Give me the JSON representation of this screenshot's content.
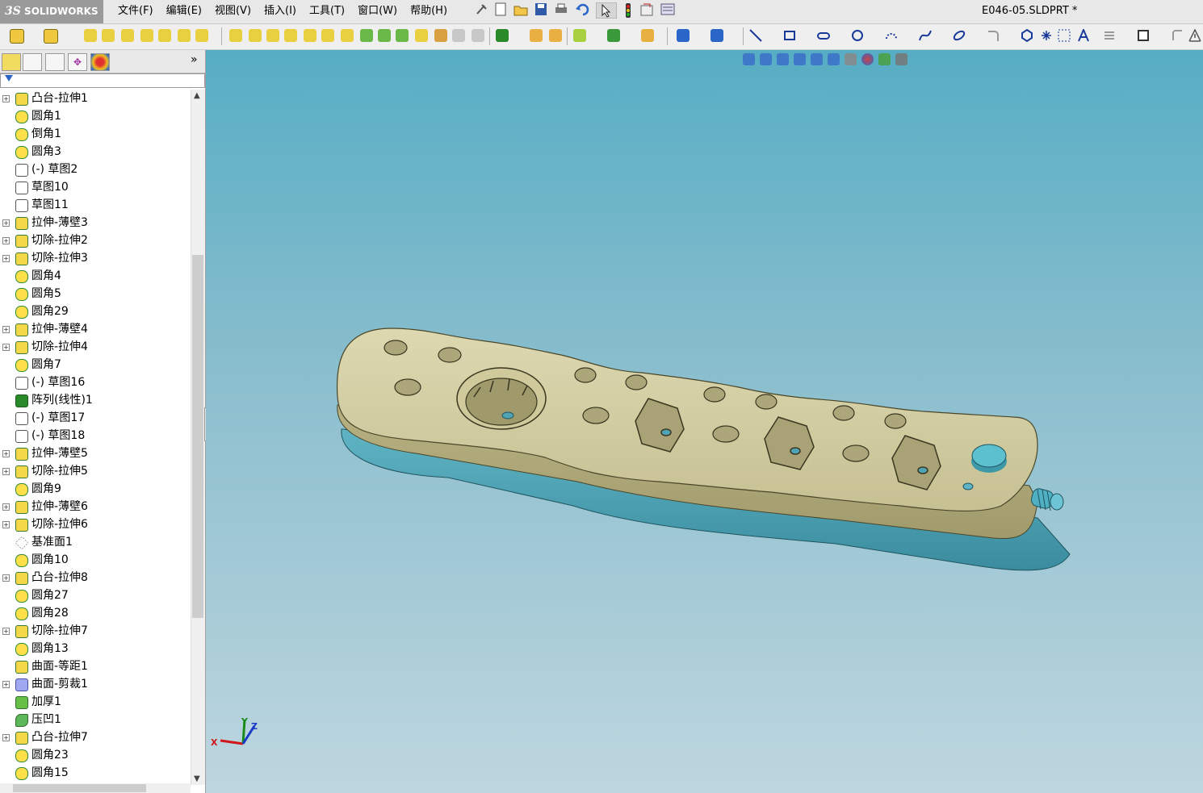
{
  "app": {
    "brand": "SOLIDWORKS",
    "brand_prefix": "3S",
    "document_title": "E046-05.SLDPRT *"
  },
  "menu": [
    "文件(F)",
    "编辑(E)",
    "视图(V)",
    "插入(I)",
    "工具(T)",
    "窗口(W)",
    "帮助(H)"
  ],
  "panel": {
    "expand_label": "»"
  },
  "feature_tree": [
    {
      "label": "凸台-拉伸1",
      "icon": "boss-extrude-icon",
      "expandable": true
    },
    {
      "label": "圆角1",
      "icon": "fillet-icon",
      "expandable": false
    },
    {
      "label": "倒角1",
      "icon": "chamfer-icon",
      "expandable": false
    },
    {
      "label": "圆角3",
      "icon": "fillet-icon",
      "expandable": false
    },
    {
      "label": "(-) 草图2",
      "icon": "sketch-icon",
      "expandable": false
    },
    {
      "label": "草图10",
      "icon": "sketch-icon",
      "expandable": false
    },
    {
      "label": "草图11",
      "icon": "sketch-icon",
      "expandable": false
    },
    {
      "label": "拉伸-薄壁3",
      "icon": "boss-extrude-icon",
      "expandable": true
    },
    {
      "label": "切除-拉伸2",
      "icon": "cut-extrude-icon",
      "expandable": true
    },
    {
      "label": "切除-拉伸3",
      "icon": "cut-extrude-icon",
      "expandable": true
    },
    {
      "label": "圆角4",
      "icon": "fillet-icon",
      "expandable": false
    },
    {
      "label": "圆角5",
      "icon": "fillet-icon",
      "expandable": false
    },
    {
      "label": "圆角29",
      "icon": "fillet-icon",
      "expandable": false
    },
    {
      "label": "拉伸-薄壁4",
      "icon": "boss-extrude-icon",
      "expandable": true
    },
    {
      "label": "切除-拉伸4",
      "icon": "cut-extrude-icon",
      "expandable": true
    },
    {
      "label": "圆角7",
      "icon": "fillet-icon",
      "expandable": false
    },
    {
      "label": "(-) 草图16",
      "icon": "sketch-icon",
      "expandable": false
    },
    {
      "label": "阵列(线性)1",
      "icon": "linear-pattern-icon",
      "expandable": false
    },
    {
      "label": "(-) 草图17",
      "icon": "sketch-icon",
      "expandable": false
    },
    {
      "label": "(-) 草图18",
      "icon": "sketch-icon",
      "expandable": false
    },
    {
      "label": "拉伸-薄壁5",
      "icon": "boss-extrude-icon",
      "expandable": true
    },
    {
      "label": "切除-拉伸5",
      "icon": "cut-extrude-icon",
      "expandable": true
    },
    {
      "label": "圆角9",
      "icon": "fillet-icon",
      "expandable": false
    },
    {
      "label": "拉伸-薄壁6",
      "icon": "boss-extrude-icon",
      "expandable": true
    },
    {
      "label": "切除-拉伸6",
      "icon": "cut-extrude-icon",
      "expandable": true
    },
    {
      "label": "基准面1",
      "icon": "plane-icon",
      "expandable": false
    },
    {
      "label": "圆角10",
      "icon": "fillet-icon",
      "expandable": false
    },
    {
      "label": "凸台-拉伸8",
      "icon": "boss-extrude-icon",
      "expandable": true
    },
    {
      "label": "圆角27",
      "icon": "fillet-icon",
      "expandable": false
    },
    {
      "label": "圆角28",
      "icon": "fillet-icon",
      "expandable": false
    },
    {
      "label": "切除-拉伸7",
      "icon": "cut-extrude-icon",
      "expandable": true
    },
    {
      "label": "圆角13",
      "icon": "fillet-icon",
      "expandable": false
    },
    {
      "label": "曲面-等距1",
      "icon": "surface-offset-icon",
      "expandable": false
    },
    {
      "label": "曲面-剪裁1",
      "icon": "surface-trim-icon",
      "expandable": true
    },
    {
      "label": "加厚1",
      "icon": "thicken-icon",
      "expandable": false
    },
    {
      "label": "压凹1",
      "icon": "indent-icon",
      "expandable": false
    },
    {
      "label": "凸台-拉伸7",
      "icon": "boss-extrude-icon",
      "expandable": true
    },
    {
      "label": "圆角23",
      "icon": "fillet-icon",
      "expandable": false
    },
    {
      "label": "圆角15",
      "icon": "fillet-icon",
      "expandable": false
    }
  ],
  "triad": {
    "x": "X",
    "y": "Y",
    "z": "Z"
  },
  "colors": {
    "viewport_top": "#56adc4",
    "viewport_bottom": "#bed6df",
    "model_top": "#d8d3a8",
    "model_base": "#4fa3b4"
  }
}
